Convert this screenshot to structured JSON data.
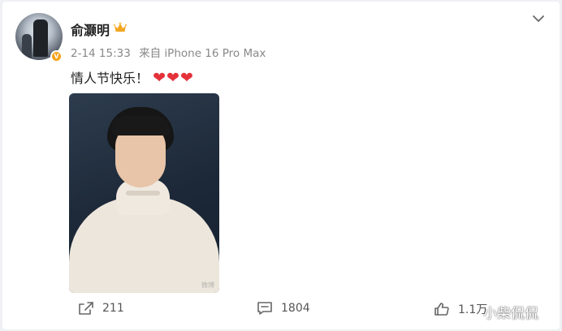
{
  "post": {
    "author": "俞灏明",
    "timestamp": "2-14 15:33",
    "source": "来自 iPhone 16 Pro Max",
    "text": "情人节快乐！",
    "emoji": "❤❤❤",
    "verified_badge": "V",
    "photo_watermark": "微博"
  },
  "actions": {
    "share_count": "211",
    "comment_count": "1804",
    "like_count": "1.1万"
  },
  "overlay_watermark": "小柴侃侃",
  "icons": {
    "crown": "crown-icon",
    "menu": "chevron-down-icon",
    "share": "share-icon",
    "comment": "comment-icon",
    "like": "thumbs-up-icon"
  },
  "colors": {
    "verified": "#f7a21b",
    "heart": "#e5323a",
    "crown": "#f5a623"
  }
}
